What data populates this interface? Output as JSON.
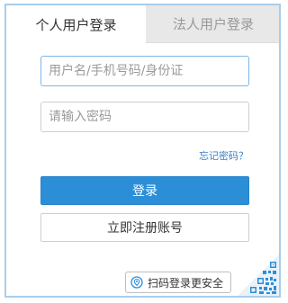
{
  "tabs": {
    "personal": "个人用户登录",
    "corporate": "法人用户登录"
  },
  "form": {
    "username_placeholder": "用户名/手机号码/身份证",
    "password_placeholder": "请输入密码",
    "forgot_password": "忘记密码？",
    "login_label": "登录",
    "register_label": "立即注册账号",
    "scan_label": "扫码登录更安全"
  },
  "colors": {
    "accent": "#2d8ed8",
    "panel_border": "#a8cdec",
    "link": "#3d7ec5"
  },
  "icons": {
    "scan": "location-pin-icon",
    "corner": "qr-code-icon"
  }
}
